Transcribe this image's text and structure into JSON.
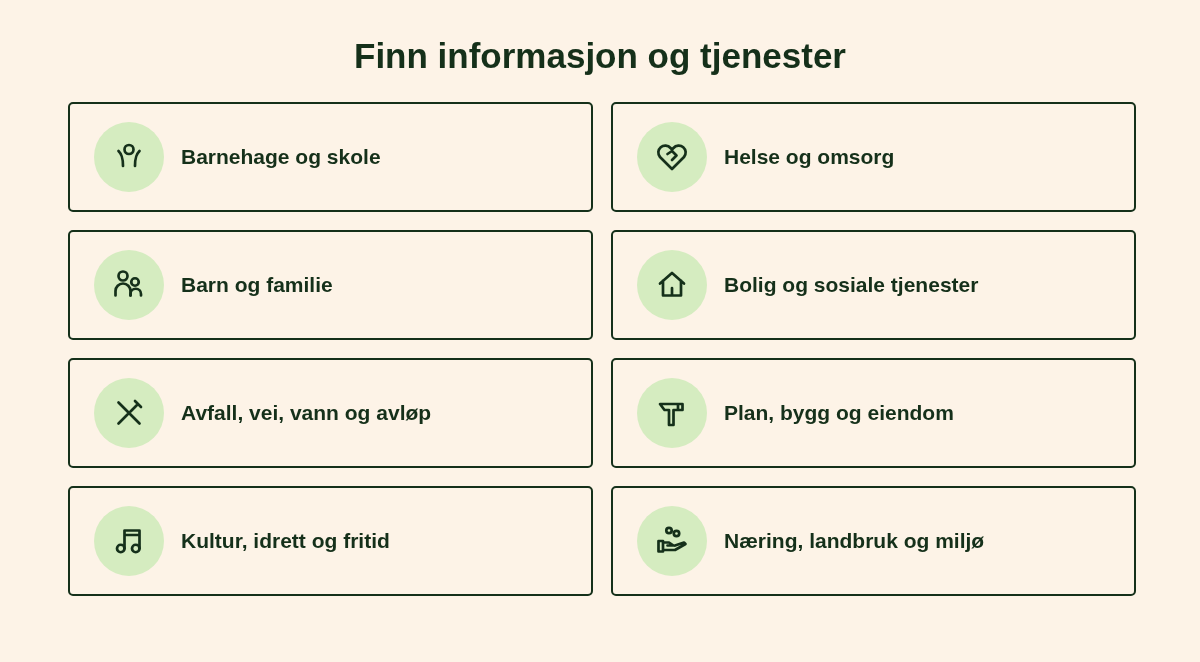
{
  "title": "Finn informasjon og tjenester",
  "cards": [
    {
      "label": "Barnehage og skole"
    },
    {
      "label": "Helse og omsorg"
    },
    {
      "label": "Barn og familie"
    },
    {
      "label": "Bolig og sosiale tjenester"
    },
    {
      "label": "Avfall, vei, vann og avløp"
    },
    {
      "label": "Plan, bygg og eiendom"
    },
    {
      "label": "Kultur, idrett og fritid"
    },
    {
      "label": "Næring, landbruk og miljø"
    }
  ]
}
